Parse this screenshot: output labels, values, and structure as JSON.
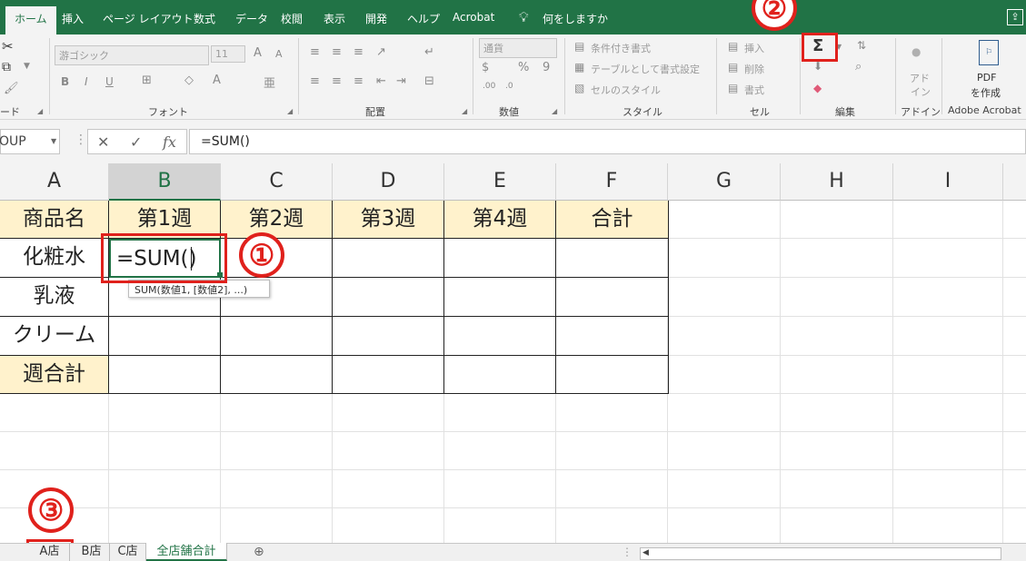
{
  "ribbon_tabs": [
    "ホーム",
    "挿入",
    "ページ レイアウト",
    "数式",
    "データ",
    "校閲",
    "表示",
    "開発",
    "ヘルプ",
    "Acrobat"
  ],
  "tell_me": "何をしますか",
  "ribbon": {
    "clipboard_label": "ード",
    "font": {
      "name": "游ゴシック",
      "size": "11",
      "bold": "B",
      "italic": "I",
      "underline": "U",
      "grow": "A",
      "shrink": "A",
      "group_label": "フォント"
    },
    "alignment": {
      "group_label": "配置"
    },
    "number": {
      "format": "通貨",
      "percent": "%",
      "comma": "9",
      "group_label": "数値"
    },
    "styles": {
      "conditional": "条件付き書式",
      "table": "テーブルとして書式設定",
      "cell_style": "セルのスタイル",
      "group_label": "スタイル"
    },
    "cells": {
      "insert": "挿入",
      "delete": "削除",
      "format": "書式",
      "group_label": "セル"
    },
    "editing": {
      "autosum": "Σ",
      "group_label": "編集"
    },
    "addins": {
      "label_line1": "アド",
      "label_line2": "イン",
      "group_label": "アドイン"
    },
    "acrobat": {
      "pdf_line1": "PDF",
      "pdf_line2": "を作成",
      "group_label": "Adobe Acrobat"
    }
  },
  "name_box": "OUP",
  "formula_bar": "=SUM()",
  "columns": [
    "A",
    "B",
    "C",
    "D",
    "E",
    "F",
    "G",
    "H",
    "I"
  ],
  "table": {
    "header": [
      "商品名",
      "第1週",
      "第2週",
      "第3週",
      "第4週",
      "合計"
    ],
    "rows": [
      [
        "化粧水",
        "=SUM()",
        "",
        "",
        "",
        ""
      ],
      [
        "乳液",
        "",
        "",
        "",
        "",
        ""
      ],
      [
        "クリーム",
        "",
        "",
        "",
        "",
        ""
      ],
      [
        "週合計",
        "",
        "",
        "",
        "",
        ""
      ]
    ]
  },
  "tooltip": "SUM(数値1, [数値2], ...)",
  "sheet_tabs": [
    "A店",
    "B店",
    "C店",
    "全店舗合計"
  ],
  "add_sheet": "⊕",
  "annotations": [
    "①",
    "②",
    "③"
  ],
  "colors": {
    "excel_green": "#217346",
    "header_fill": "#fff2cc",
    "annotation_red": "#e0211c"
  }
}
